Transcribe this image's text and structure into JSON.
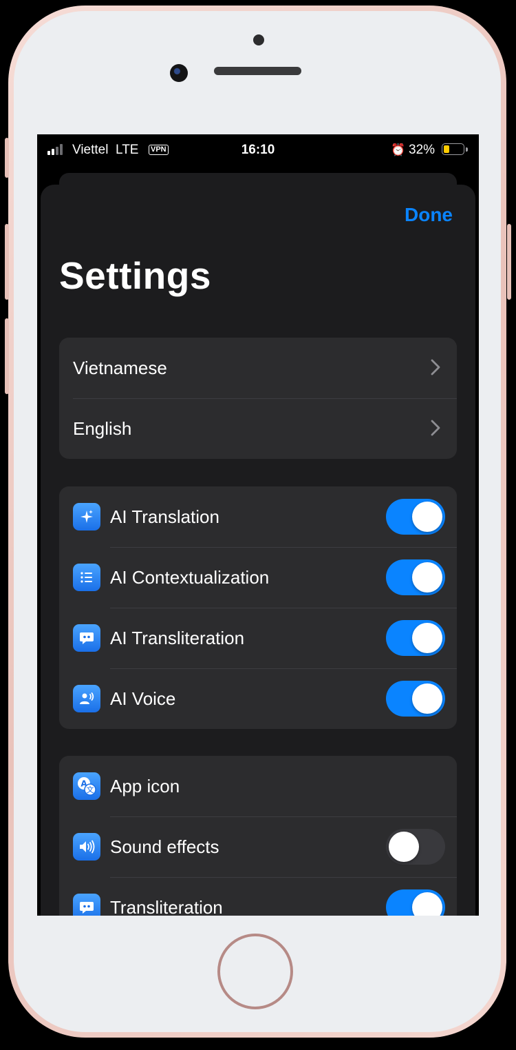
{
  "status_bar": {
    "carrier": "Viettel",
    "network": "LTE",
    "vpn": "VPN",
    "time": "16:10",
    "battery_percent": "32%",
    "battery_level": 0.32,
    "signal_bars_active": 2
  },
  "header": {
    "done_label": "Done",
    "title": "Settings"
  },
  "languages": [
    {
      "label": "Vietnamese"
    },
    {
      "label": "English"
    }
  ],
  "ai_features": [
    {
      "label": "AI Translation",
      "icon": "sparkles-icon",
      "enabled": true
    },
    {
      "label": "AI Contextualization",
      "icon": "list-icon",
      "enabled": true
    },
    {
      "label": "AI Transliteration",
      "icon": "quote-bubble-icon",
      "enabled": true
    },
    {
      "label": "AI Voice",
      "icon": "person-wave-icon",
      "enabled": true
    }
  ],
  "general": [
    {
      "label": "App icon",
      "icon": "translate-icon"
    },
    {
      "label": "Sound effects",
      "icon": "speaker-icon",
      "enabled": false
    },
    {
      "label": "Transliteration",
      "icon": "quote-bubble-icon",
      "enabled": true
    }
  ],
  "colors": {
    "accent": "#0a84ff",
    "sheet_background": "#1c1c1e",
    "group_background": "#2c2c2e",
    "phone_frame": "#f0d0c8",
    "battery_fill": "#ffcc00"
  }
}
